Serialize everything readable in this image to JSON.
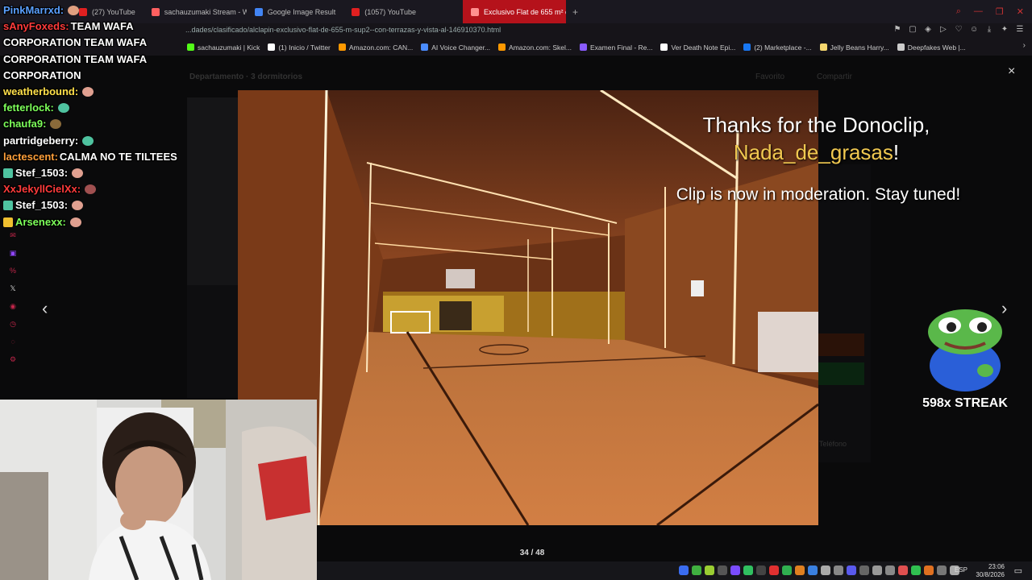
{
  "browser": {
    "tabs": [
      {
        "label": "(27) YouTube",
        "color": "#e02020"
      },
      {
        "label": "sachauzumaki Stream - W...",
        "color": "#ff6060"
      },
      {
        "label": "Google Image Result",
        "color": "#4285f4"
      },
      {
        "label": "(1057) YouTube",
        "color": "#e02020"
      },
      {
        "label": "Exclusivo Flat de 655 m² c...",
        "color": "#ff9090",
        "active": true
      }
    ],
    "new_tab": "+",
    "url": "...dades/clasificado/alclapin-exclusivo-flat-de-655-m-sup2--con-terrazas-y-vista-al-146910370.html",
    "bookmarks": [
      {
        "label": "sachauzumaki | Kick",
        "color": "#53fc18"
      },
      {
        "label": "(1) Inicio / Twitter",
        "color": "#ffffff"
      },
      {
        "label": "Amazon.com: CAN...",
        "color": "#ff9900"
      },
      {
        "label": "AI Voice Changer...",
        "color": "#4a8cff"
      },
      {
        "label": "Amazon.com: Skel...",
        "color": "#ff9900"
      },
      {
        "label": "Examen Final - Re...",
        "color": "#8a5cff"
      },
      {
        "label": "Ver Death Note Epi...",
        "color": "#ffffff"
      },
      {
        "label": "(2) Marketplace -...",
        "color": "#1877f2"
      },
      {
        "label": "Jelly Beans Harry...",
        "color": "#f5d76e"
      },
      {
        "label": "Deepfakes Web |...",
        "color": "#cccccc"
      }
    ]
  },
  "page": {
    "title": "Departamento · 3 dormitorios",
    "favorite": "Favorito",
    "share": "Compartir",
    "phone": "Teléfono"
  },
  "gallery": {
    "counter": "34 / 48",
    "close": "×",
    "prev": "‹",
    "next": "›"
  },
  "chat": [
    {
      "user": "PinkMarrxd:",
      "text": "",
      "color": "#5aa0ff",
      "emote": "#e0a080"
    },
    {
      "user": "sAnyFoxeds:",
      "text": "TEAM WAFA CORPORATION TEAM WAFA CORPORATION TEAM WAFA CORPORATION",
      "color": "#ff3b3b",
      "emote": ""
    },
    {
      "user": "weatherbound:",
      "text": "",
      "color": "#ffe04a",
      "emote": "#e0a090"
    },
    {
      "user": "fetterlock:",
      "text": "",
      "color": "#7dff5a",
      "emote": "#4fc3a0"
    },
    {
      "user": "chaufa9:",
      "text": "",
      "color": "#7dff5a",
      "emote": "#8a6a3a"
    },
    {
      "user": "partridgeberry:",
      "text": "",
      "color": "#ffffff",
      "emote": "#4fc3a0"
    },
    {
      "user": "lactescent:",
      "text": "CALMA NO TE TILTEES",
      "color": "#ff9f3a",
      "emote": ""
    },
    {
      "user": "Stef_1503:",
      "text": "",
      "color": "#ffffff",
      "emote": "#e0a090",
      "badge": "#4fc3a0"
    },
    {
      "user": "XxJekyllCielXx:",
      "text": "",
      "color": "#ff3b3b",
      "emote": "#a05050"
    },
    {
      "user": "Stef_1503:",
      "text": "",
      "color": "#ffffff",
      "emote": "#e0a090",
      "badge": "#4fc3a0"
    },
    {
      "user": "Arsenexx:",
      "text": "",
      "color": "#7dff5a",
      "emote": "#e0a090",
      "badge": "#f0c030"
    }
  ],
  "alert": {
    "line1": "Thanks for the Donoclip,",
    "donor": "Nada_de_grasas",
    "bang": "!",
    "line3": "Clip is now in moderation. Stay tuned!"
  },
  "streak": {
    "label": "598x STREAK"
  },
  "taskbar": {
    "lang": "ESP",
    "time": "23:06",
    "date": "30/8/2026"
  }
}
